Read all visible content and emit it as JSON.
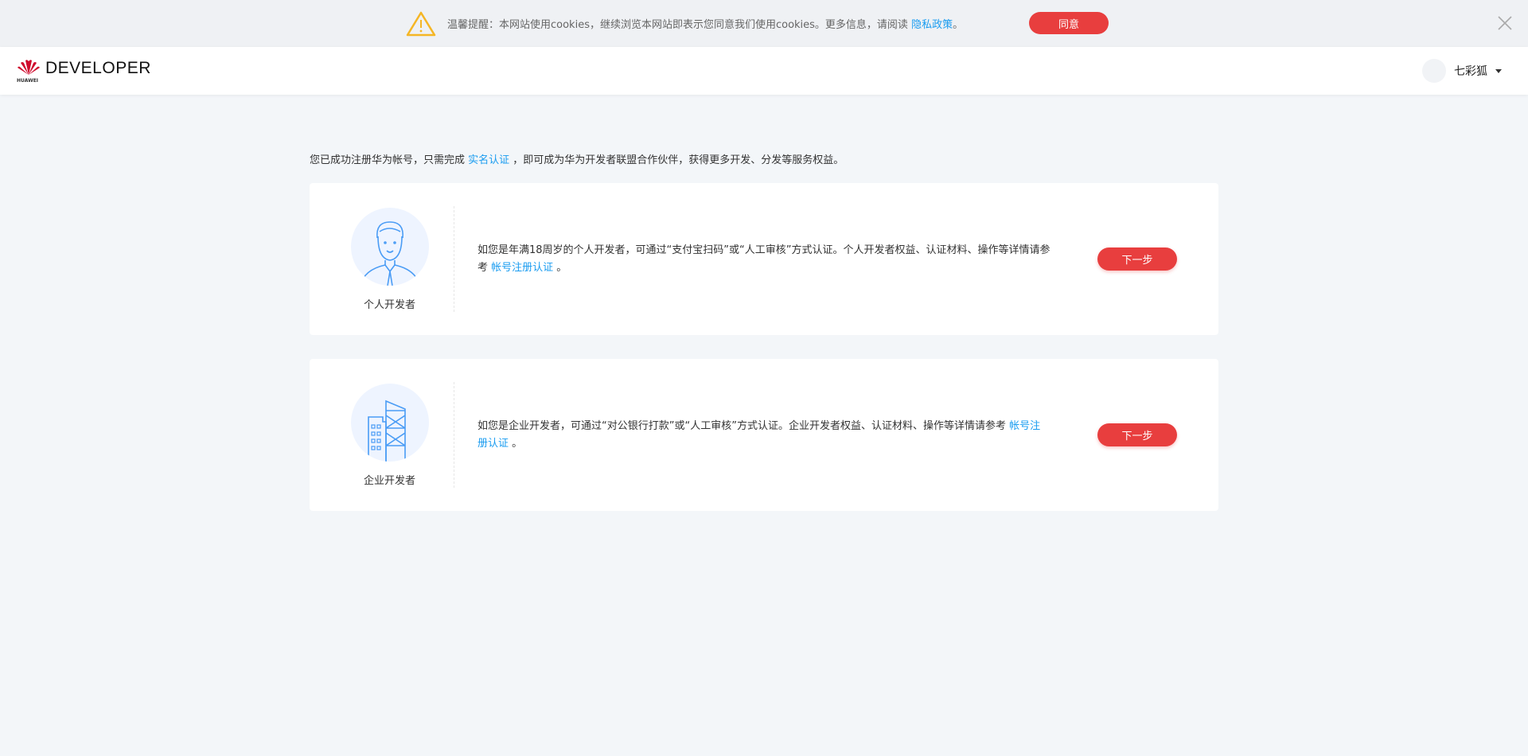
{
  "cookie_banner": {
    "message": "温馨提醒：本网站使用cookies，继续浏览本网站即表示您同意我们使用cookies。更多信息，请阅读 ",
    "link": "隐私政策",
    "suffix": "。",
    "agree_label": "同意"
  },
  "header": {
    "brand_small": "HUAWEI",
    "brand": "DEVELOPER",
    "username": "七彩狐"
  },
  "intro": {
    "prefix": "您已成功注册华为帐号，只需完成 ",
    "link": "实名认证",
    "suffix": " ，即可成为华为开发者联盟合作伙伴，获得更多开发、分发等服务权益。"
  },
  "cards": [
    {
      "title": "个人开发者",
      "desc": "如您是年满18周岁的个人开发者，可通过“支付宝扫码”或“人工审核”方式认证。个人开发者权益、认证材料、操作等详情请参考 ",
      "link": "帐号注册认证",
      "suffix": " 。",
      "button": "下一步"
    },
    {
      "title": "企业开发者",
      "desc": "如您是企业开发者，可通过“对公银行打款”或“人工审核”方式认证。企业开发者权益、认证材料、操作等详情请参考 ",
      "link": "帐号注册认证",
      "suffix": " 。",
      "button": "下一步"
    }
  ],
  "colors": {
    "accent": "#e83e3e",
    "link": "#1a9cf0",
    "warning": "#f5b625"
  }
}
